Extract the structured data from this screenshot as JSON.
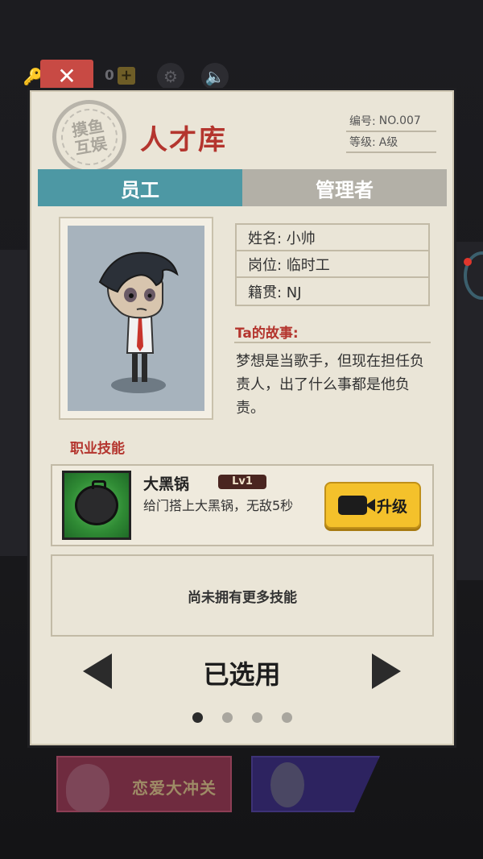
{
  "topbar": {
    "coin_count": "0",
    "plus_label": "+"
  },
  "close_glyph": "✕",
  "panel": {
    "stamp_text": "摸鱼互娱",
    "title": "人才库",
    "info": {
      "number_key": "编号:",
      "number_value": "NO.007",
      "grade_key": "等级:",
      "grade_value": "A级"
    },
    "tabs": [
      {
        "label": "员工",
        "active": true
      },
      {
        "label": "管理者",
        "active": false
      }
    ],
    "fields": {
      "name": "姓名: 小帅",
      "position": "岗位: 临时工",
      "origin": "籍贯: NJ"
    },
    "story_title": "Ta的故事:",
    "story_text": "梦想是当歌手，但现在担任负责人，出了什么事都是他负责。",
    "skills_title": "职业技能",
    "skill": {
      "name": "大黑锅",
      "level": "Lv1",
      "description": "给门搭上大黑锅，无敌5秒",
      "upgrade_label": "升级"
    },
    "no_more_skills": "尚未拥有更多技能",
    "selected_label": "已选用",
    "page_dots": {
      "count": 4,
      "active_index": 0
    }
  },
  "bottom_cards": {
    "love_label": "恋爱大冲关"
  },
  "colors": {
    "accent_red": "#b4352e",
    "tab_active": "#4d98a4",
    "tab_inactive": "#b3b0a7",
    "button_yellow": "#f4c12b",
    "panel_bg": "#eae5d7"
  }
}
